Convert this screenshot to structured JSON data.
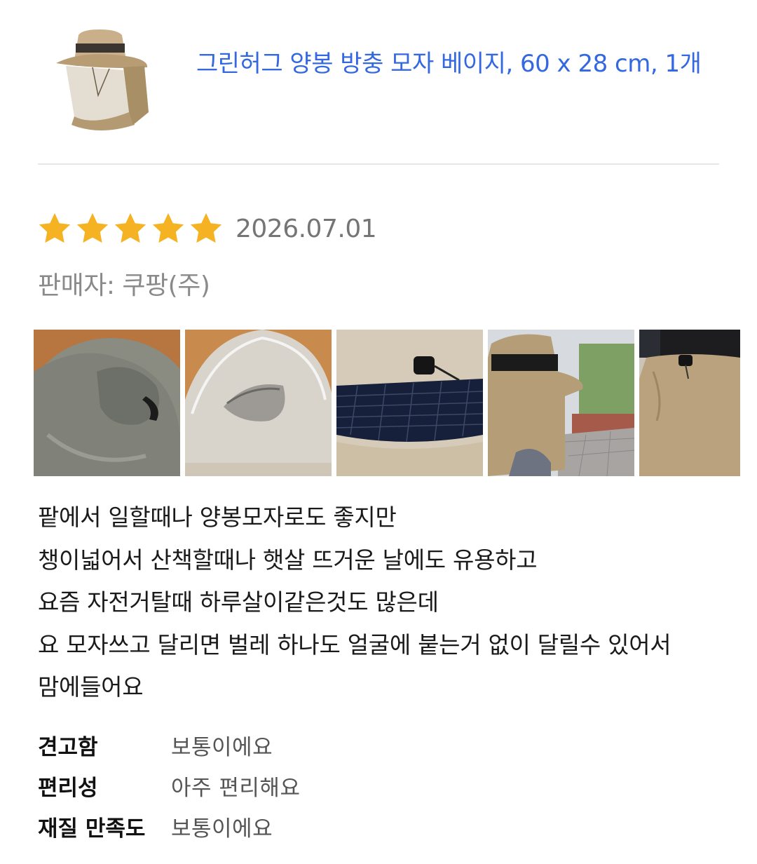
{
  "product": {
    "title": "그린허그 양봉 방충 모자 베이지, 60 x 28 cm, 1개",
    "thumbnail_icon": "beekeeping-net-hat-photo"
  },
  "review": {
    "rating": 5,
    "rating_max": 5,
    "date": "2026.07.01",
    "seller": "판매자: 쿠팡(주)",
    "photos": [
      "hat-brim-inside-photo",
      "hat-net-close-up-photo",
      "drawstring-toggle-mesh-photo",
      "person-wearing-hat-photo",
      "hat-neck-flap-photo"
    ],
    "body_lines": [
      "팥에서 일할때나 양봉모자로도 좋지만",
      "챙이넓어서 산책할때나 햇살 뜨거운 날에도 유용하고",
      "요즘 자전거탈때 하루살이같은것도 많은데",
      "요 모자쓰고 달리면 벌레 하나도 얼굴에 붙는거 없이 달릴수 있어서",
      "맘에들어요"
    ],
    "survey": [
      {
        "question": "견고함",
        "answer": "보통이에요"
      },
      {
        "question": "편리성",
        "answer": "아주 편리해요"
      },
      {
        "question": "재질 만족도",
        "answer": "보통이에요"
      }
    ]
  },
  "colors": {
    "link": "#3468e0",
    "star": "#f5b324",
    "meta_text": "#757575"
  }
}
